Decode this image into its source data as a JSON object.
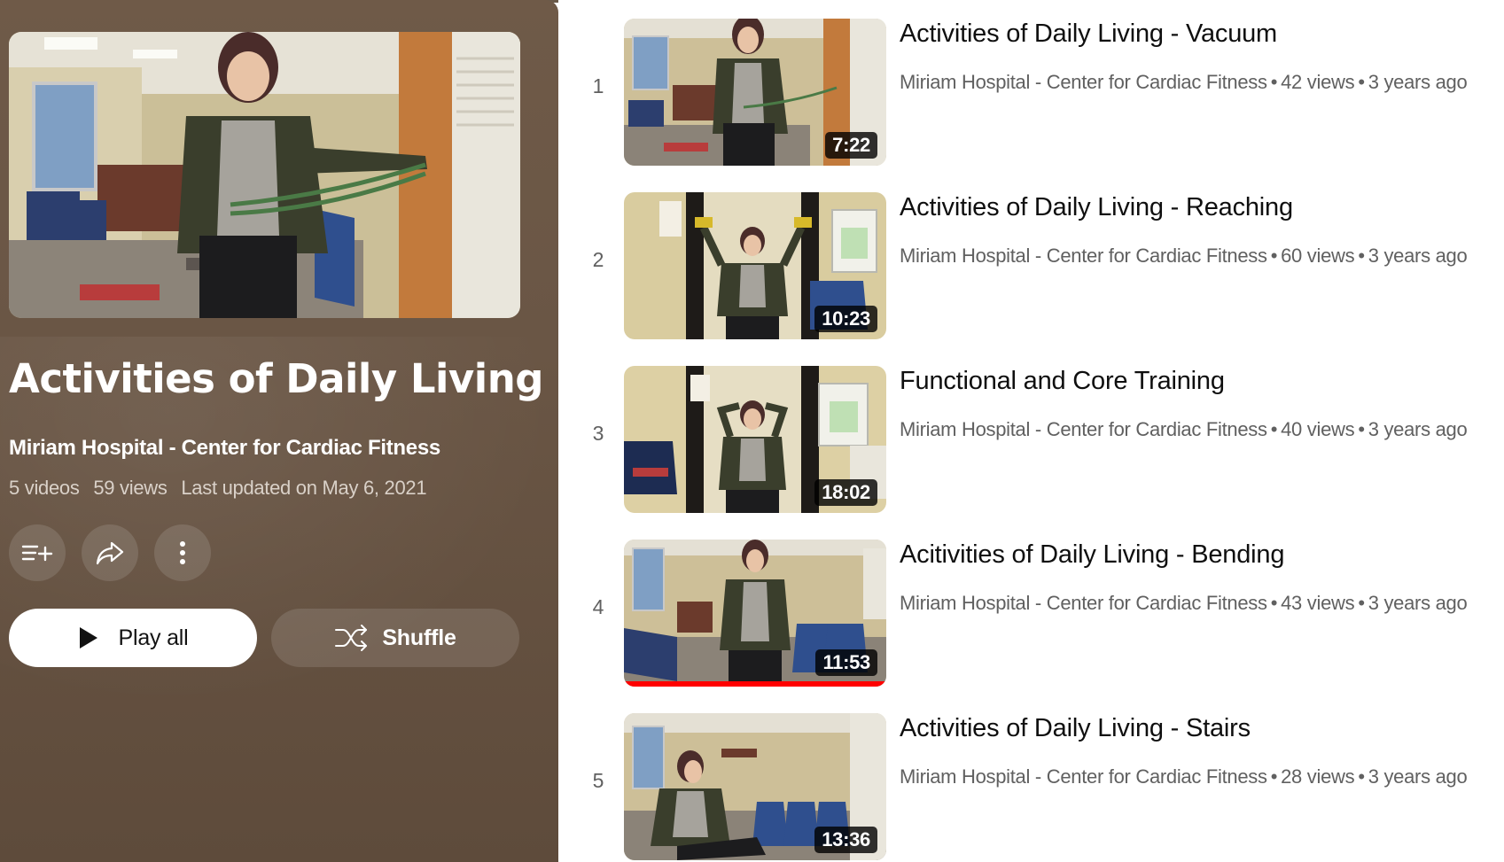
{
  "playlist": {
    "title": "Activities of Daily Living",
    "channel": "Miriam Hospital - Center for Cardiac Fitness",
    "video_count": "5 videos",
    "views": "59 views",
    "last_updated": "Last updated on May 6, 2021",
    "actions": {
      "save_icon": "playlist-add-icon",
      "share_icon": "share-icon",
      "more_icon": "more-vertical-icon"
    },
    "play_all_label": "Play all",
    "shuffle_label": "Shuffle"
  },
  "colors": {
    "panel_bg": "#6a5645",
    "progress_red": "#ff0000",
    "title_text": "#0f0f0f",
    "meta_text": "#606060"
  },
  "videos": [
    {
      "index": "1",
      "title": "Activities of Daily Living - Vacuum",
      "channel": "Miriam Hospital - Center for Cardiac Fitness",
      "views": "42 views",
      "age": "3 years ago",
      "duration": "7:22",
      "watched_fraction": 0
    },
    {
      "index": "2",
      "title": "Activities of Daily Living - Reaching",
      "channel": "Miriam Hospital - Center for Cardiac Fitness",
      "views": "60 views",
      "age": "3 years ago",
      "duration": "10:23",
      "watched_fraction": 0
    },
    {
      "index": "3",
      "title": "Functional and Core Training",
      "channel": "Miriam Hospital - Center for Cardiac Fitness",
      "views": "40 views",
      "age": "3 years ago",
      "duration": "18:02",
      "watched_fraction": 0
    },
    {
      "index": "4",
      "title": "Acitivities of Daily Living - Bending",
      "channel": "Miriam Hospital - Center for Cardiac Fitness",
      "views": "43 views",
      "age": "3 years ago",
      "duration": "11:53",
      "watched_fraction": 1.0
    },
    {
      "index": "5",
      "title": "Activities of Daily Living - Stairs",
      "channel": "Miriam Hospital - Center for Cardiac Fitness",
      "views": "28 views",
      "age": "3 years ago",
      "duration": "13:36",
      "watched_fraction": 0
    }
  ]
}
